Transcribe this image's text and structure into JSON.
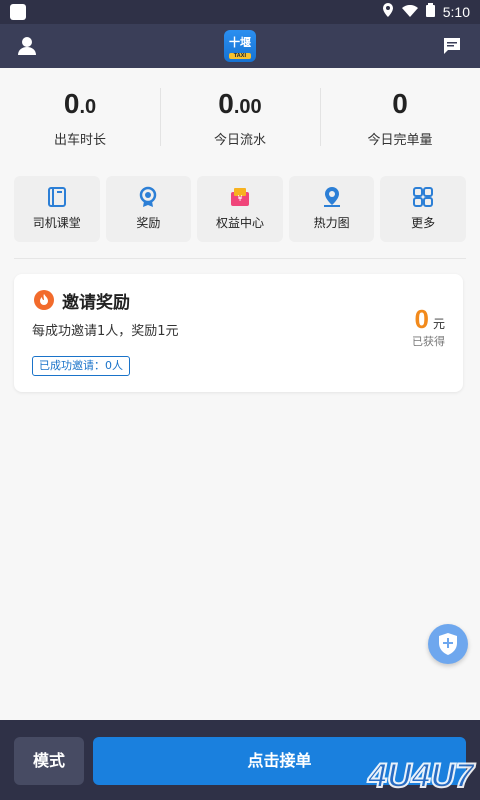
{
  "statusbar": {
    "time": "5:10"
  },
  "app": {
    "logo_text": "十堰",
    "logo_sub": "TAXI"
  },
  "stats": [
    {
      "int": "0",
      "dec": ".0",
      "label": "出车时长"
    },
    {
      "int": "0",
      "dec": ".00",
      "label": "今日流水"
    },
    {
      "int": "0",
      "dec": "",
      "label": "今日完单量"
    }
  ],
  "quick": [
    {
      "label": "司机课堂",
      "icon": "book-icon"
    },
    {
      "label": "奖励",
      "icon": "medal-icon"
    },
    {
      "label": "权益中心",
      "icon": "gift-icon"
    },
    {
      "label": "热力图",
      "icon": "map-pin-icon"
    },
    {
      "label": "更多",
      "icon": "grid-icon"
    }
  ],
  "invite": {
    "title": "邀请奖励",
    "desc": "每成功邀请1人，奖励1元",
    "badge": "已成功邀请：0人",
    "amount": "0",
    "unit": "元",
    "earned": "已获得"
  },
  "bottom": {
    "mode": "模式",
    "accept": "点击接单"
  },
  "watermark": "4U4U7"
}
